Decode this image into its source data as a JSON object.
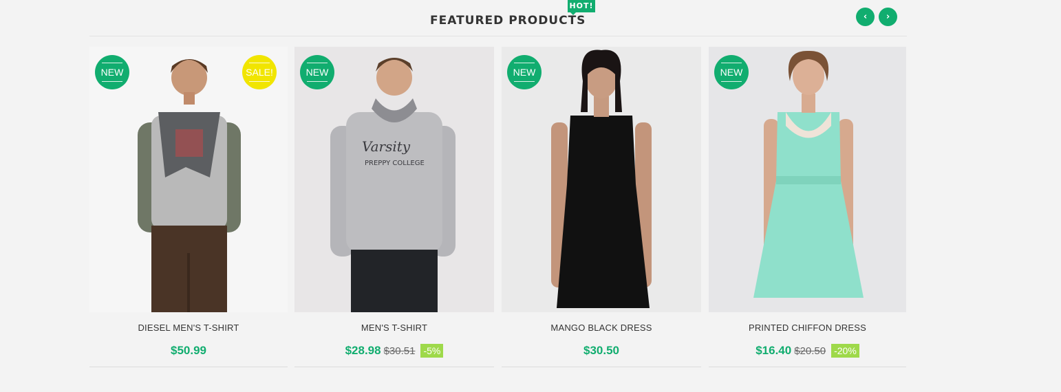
{
  "section": {
    "title": "FEATURED PRODUCTS",
    "hot_badge": "HOT!",
    "prev_icon": "‹",
    "next_icon": "›"
  },
  "products": [
    {
      "name": "DIESEL MEN'S T-SHIRT",
      "price": "$50.99",
      "old_price": "",
      "discount": "",
      "badge_new": "NEW",
      "badge_sale": "SALE!"
    },
    {
      "name": "MEN'S T-SHIRT",
      "price": "$28.98",
      "old_price": "$30.51",
      "discount": "-5%",
      "badge_new": "NEW",
      "badge_sale": ""
    },
    {
      "name": "MANGO BLACK DRESS",
      "price": "$30.50",
      "old_price": "",
      "discount": "",
      "badge_new": "NEW",
      "badge_sale": ""
    },
    {
      "name": "PRINTED CHIFFON DRESS",
      "price": "$16.40",
      "old_price": "$20.50",
      "discount": "-20%",
      "badge_new": "NEW",
      "badge_sale": ""
    }
  ],
  "colors": {
    "accent": "#11ad6f",
    "sale": "#f1e500",
    "discount": "#9ed94a"
  }
}
